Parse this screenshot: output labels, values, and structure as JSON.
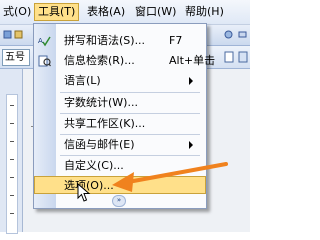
{
  "menubar": {
    "items": [
      {
        "label": "式(O)"
      },
      {
        "label": "工具(T)"
      },
      {
        "label": "表格(A)"
      },
      {
        "label": "窗口(W)"
      },
      {
        "label": "帮助(H)"
      }
    ]
  },
  "format_bar": {
    "font_size": "五号"
  },
  "tools_menu": {
    "items": [
      {
        "label": "拼写和语法(S)...",
        "shortcut": "F7",
        "icon": "spellcheck-icon"
      },
      {
        "label": "信息检索(R)...",
        "shortcut": "Alt+单击",
        "icon": "research-icon"
      },
      {
        "label": "语言(L)",
        "submenu": true
      },
      {
        "label": "字数统计(W)..."
      },
      {
        "label": "共享工作区(K)..."
      },
      {
        "label": "信函与邮件(E)",
        "submenu": true
      },
      {
        "label": "自定义(C)..."
      },
      {
        "label": "选项(O)...",
        "highlighted": true
      }
    ],
    "expand_glyph": "»"
  },
  "colors": {
    "highlight": "#ffe08a",
    "annotation_arrow": "#f0821e",
    "menu_gutter": "#c9d7ee"
  }
}
